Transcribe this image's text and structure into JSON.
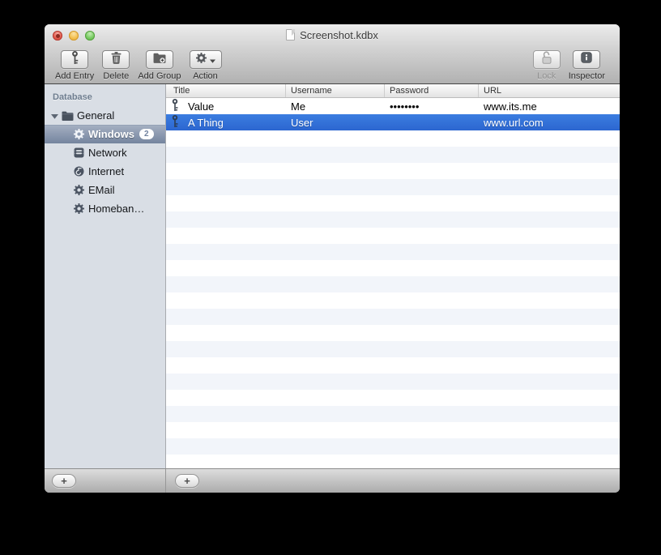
{
  "titlebar": {
    "title": "Screenshot.kdbx"
  },
  "toolbar": {
    "add_entry": {
      "label": "Add Entry"
    },
    "delete": {
      "label": "Delete"
    },
    "add_group": {
      "label": "Add Group"
    },
    "action": {
      "label": "Action"
    },
    "lock": {
      "label": "Lock",
      "enabled": false
    },
    "inspector": {
      "label": "Inspector"
    }
  },
  "sidebar": {
    "header": "Database",
    "items": [
      {
        "label": "General",
        "icon": "folder-icon",
        "expanded": true
      },
      {
        "label": "Windows",
        "icon": "gear-icon",
        "badge": "2",
        "selected": true
      },
      {
        "label": "Network",
        "icon": "network-icon"
      },
      {
        "label": "Internet",
        "icon": "globe-icon"
      },
      {
        "label": "EMail",
        "icon": "gear-icon"
      },
      {
        "label": "Homeban…",
        "icon": "gear-icon"
      }
    ],
    "add_button": "+"
  },
  "table": {
    "columns": {
      "title": "Title",
      "username": "Username",
      "password": "Password",
      "url": "URL"
    },
    "rows": [
      {
        "title": "Value",
        "username": "Me",
        "password": "••••••••",
        "url": "www.its.me",
        "selected": false
      },
      {
        "title": "A Thing",
        "username": "User",
        "password": "",
        "url": "www.url.com",
        "selected": true
      }
    ],
    "add_button": "+"
  },
  "colors": {
    "row_selection": "#2f6fd9",
    "sidebar_selection": "#74849e",
    "row_stripe": "#f2f5fa",
    "sidebar_bg": "#d9dee5"
  }
}
